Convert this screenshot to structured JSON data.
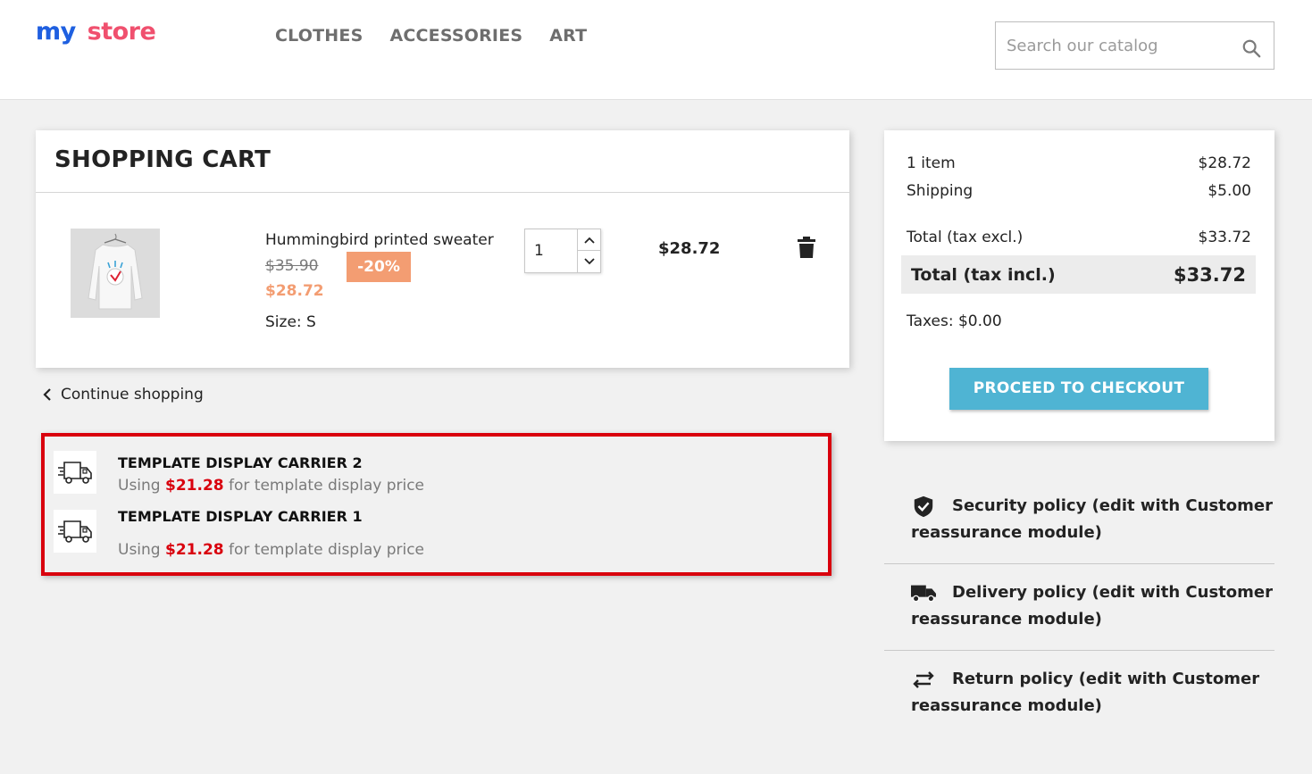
{
  "header": {
    "logo": {
      "part1": "my",
      "part2": "store"
    },
    "nav": [
      "CLOTHES",
      "ACCESSORIES",
      "ART"
    ],
    "search_placeholder": "Search our catalog"
  },
  "cart": {
    "title": "SHOPPING CART",
    "item": {
      "name": "Hummingbird printed sweater",
      "old_price": "$35.90",
      "discount": "-20%",
      "new_price": "$28.72",
      "size": "Size: S",
      "quantity": "1",
      "line_total": "$28.72"
    },
    "continue_label": "Continue shopping"
  },
  "carriers": [
    {
      "name": "TEMPLATE DISPLAY CARRIER 2",
      "desc_prefix": "Using",
      "price": "$21.28",
      "desc_suffix": "for template display price"
    },
    {
      "name": "TEMPLATE DISPLAY CARRIER 1",
      "desc_prefix": "Using",
      "price": "$21.28",
      "desc_suffix": "for template display price"
    }
  ],
  "summary": {
    "items_label": "1 item",
    "items_value": "$28.72",
    "shipping_label": "Shipping",
    "shipping_value": "$5.00",
    "total_excl_label": "Total (tax excl.)",
    "total_excl_value": "$33.72",
    "total_incl_label": "Total (tax incl.)",
    "total_incl_value": "$33.72",
    "taxes": "Taxes: $0.00",
    "checkout_label": "PROCEED TO CHECKOUT"
  },
  "reassurance": [
    {
      "icon": "shield-check-icon",
      "label": "Security policy (edit with Customer reassurance module)"
    },
    {
      "icon": "truck-icon",
      "label": "Delivery policy (edit with Customer reassurance module)"
    },
    {
      "icon": "swap-arrows-icon",
      "label": "Return policy (edit with Customer reassurance module)"
    }
  ],
  "colors": {
    "accent": "#4fb4d3",
    "discount": "#f39d72",
    "carrier_price": "#d9000d",
    "highlight_border": "#d9000d"
  }
}
